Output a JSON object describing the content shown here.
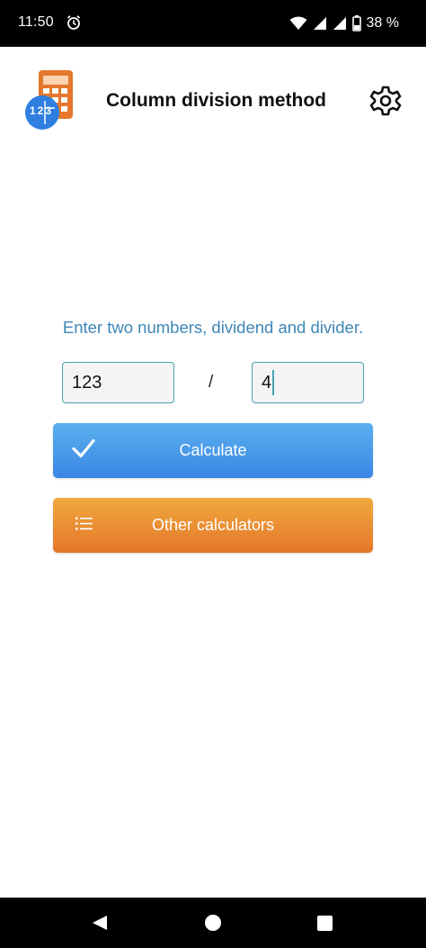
{
  "status_bar": {
    "time": "11:50",
    "battery": "38 %",
    "icons": [
      "alarm-icon",
      "wifi-icon",
      "signal-icon",
      "signal-icon",
      "battery-icon"
    ]
  },
  "header": {
    "title": "Column division method",
    "logo_text": "123"
  },
  "main": {
    "prompt": "Enter two numbers, dividend and divider.",
    "dividend_value": "123",
    "operator": "/",
    "divider_value": "4",
    "calculate_label": "Calculate",
    "other_label": "Other calculators"
  },
  "colors": {
    "accent_blue": "#3a86e4",
    "accent_orange": "#e4772c",
    "prompt_text": "#3d87b6",
    "input_border": "#46a3b0"
  }
}
